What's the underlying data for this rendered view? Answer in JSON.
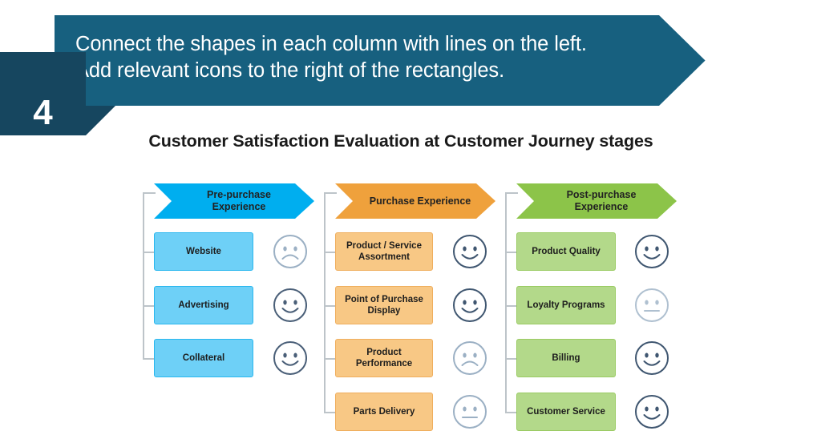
{
  "banner": {
    "number": "4",
    "instruction": "Connect the shapes in each column with lines on the left.\nAdd relevant icons to the right of the rectangles.",
    "bg_color": "#17607F",
    "badge_color": "#16465F"
  },
  "slide_title": "Customer Satisfaction Evaluation at Customer Journey stages",
  "columns": [
    {
      "header_label": "Pre-purchase\nExperience",
      "header_color": "#00AEEF",
      "box_fill": "#6ED0F7",
      "box_border": "#29B7EE",
      "rows": [
        {
          "label": "Website",
          "face": "sad",
          "face_color": "#9BB0C4"
        },
        {
          "label": "Advertising",
          "face": "happy",
          "face_color": "#4A5F78"
        },
        {
          "label": "Collateral",
          "face": "happy",
          "face_color": "#4A5F78"
        }
      ]
    },
    {
      "header_label": "Purchase Experience",
      "header_color": "#EFA13C",
      "box_fill": "#F8C885",
      "box_border": "#EFAE5E",
      "rows": [
        {
          "label": "Product / Service\nAssortment",
          "face": "happy",
          "face_color": "#3F5670"
        },
        {
          "label": "Point of Purchase\nDisplay",
          "face": "happy",
          "face_color": "#3F5670"
        },
        {
          "label": "Product\nPerformance",
          "face": "sad",
          "face_color": "#9BB0C4"
        },
        {
          "label": "Parts Delivery",
          "face": "neutral",
          "face_color": "#9BB0C4"
        }
      ]
    },
    {
      "header_label": "Post-purchase\nExperience",
      "header_color": "#8CC449",
      "box_fill": "#B3D98A",
      "box_border": "#9ACB63",
      "rows": [
        {
          "label": "Product Quality",
          "face": "happy",
          "face_color": "#3F5670"
        },
        {
          "label": "Loyalty Programs",
          "face": "neutral",
          "face_color": "#AFC0D0"
        },
        {
          "label": "Billing",
          "face": "happy",
          "face_color": "#3F5670"
        },
        {
          "label": "Customer Service",
          "face": "happy",
          "face_color": "#3F5670"
        }
      ]
    }
  ],
  "connector_color": "#BDC4C9"
}
